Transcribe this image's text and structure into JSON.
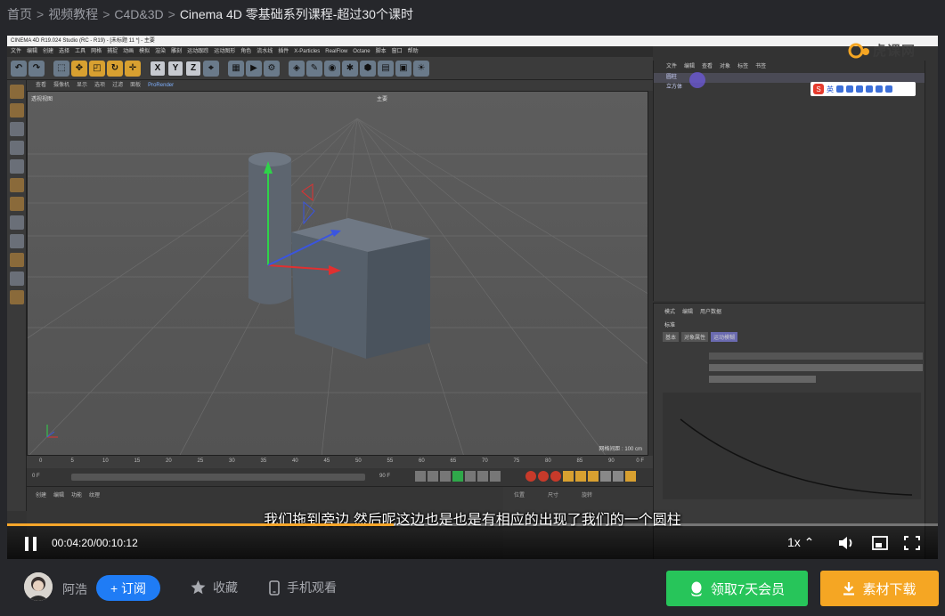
{
  "breadcrumb": {
    "items": [
      "首页",
      "视频教程",
      "C4D&3D"
    ],
    "separator": ">",
    "current": "Cinema 4D 零基础系列课程-超过30个课时"
  },
  "video": {
    "app_title": "CINEMA 4D R19.024 Studio (RC - R19) - [未标题 11 *] - 主要",
    "app_menu": [
      "文件",
      "编辑",
      "创建",
      "选择",
      "工具",
      "网格",
      "捕捉",
      "动画",
      "模拟",
      "渲染",
      "雕刻",
      "运动跟踪",
      "运动图形",
      "角色",
      "流水线",
      "插件",
      "X-Particles",
      "RealFlow",
      "Octane",
      "脚本",
      "窗口",
      "帮助"
    ],
    "viewport_menu": [
      "查看",
      "摄像机",
      "显示",
      "选项",
      "过滤",
      "面板"
    ],
    "viewport_menu_extra": "ProRender",
    "viewport_name": "透视视图",
    "viewport_grid": "网格间距 : 100 cm",
    "viewport_badge": "主要",
    "timeline_ticks": [
      "0",
      "5",
      "10",
      "15",
      "20",
      "25",
      "30",
      "35",
      "40",
      "45",
      "50",
      "55",
      "60",
      "65",
      "70",
      "75",
      "80",
      "85",
      "90"
    ],
    "timeline_frame": "0 F",
    "transport_start": "0 F",
    "transport_end": "90 F",
    "object_tabs": [
      "文件",
      "编辑",
      "查看",
      "对象",
      "标签",
      "书签"
    ],
    "objects": [
      "圆柱",
      "立方体"
    ],
    "attr_tabs": [
      "模式",
      "编辑",
      "用户数据"
    ],
    "attr_title": "标准",
    "attr_subtabs": [
      "基本",
      "对象属性",
      "运动模糊"
    ],
    "lower_tabs": [
      "创建",
      "编辑",
      "功能",
      "纹理"
    ],
    "coord_headers": [
      "位置",
      "尺寸",
      "旋转"
    ],
    "ime_text": "英",
    "watermark": "虎课网",
    "subtitle": "我们拖到旁边 然后呢这边也是也是有相应的出现了我们的一个圆柱",
    "progress": 0.415,
    "time_display": "00:04:20/00:10:12",
    "speed": "1x"
  },
  "bottom": {
    "author": "阿浩",
    "subscribe_label": "+ 订阅",
    "favorite_label": "收藏",
    "mobile_label": "手机观看",
    "vip_label": "领取7天会员",
    "download_label": "素材下载"
  },
  "colors": {
    "accent_blue": "#1f7cf5",
    "vip_green": "#27c55a",
    "download_orange": "#f5a623",
    "progress_orange": "#f7a62a",
    "page_bg": "#26272b"
  }
}
